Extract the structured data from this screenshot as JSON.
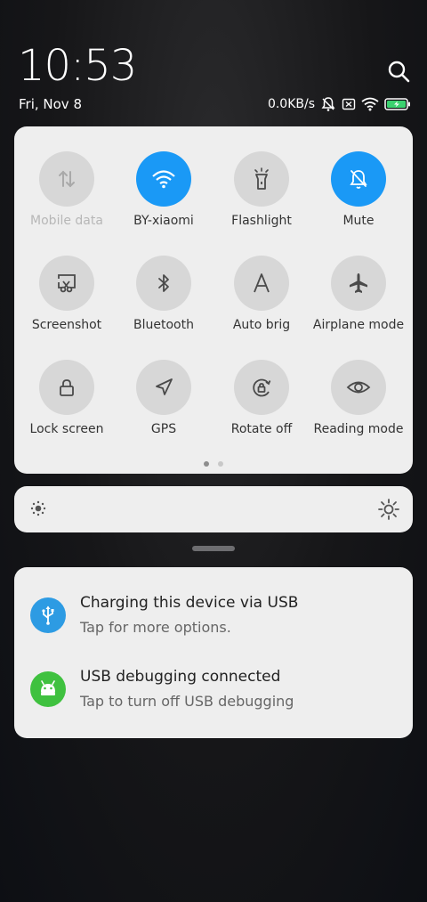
{
  "status": {
    "time": "10:53",
    "date": "Fri, Nov 8",
    "net_speed": "0.0KB/s"
  },
  "tiles": [
    {
      "label": "Mobile data",
      "state": "disabled",
      "icon": "mobile-data-icon"
    },
    {
      "label": "BY-xiaomi",
      "state": "on",
      "icon": "wifi-icon"
    },
    {
      "label": "Flashlight",
      "state": "off",
      "icon": "flashlight-icon"
    },
    {
      "label": "Mute",
      "state": "on",
      "icon": "mute-bell-icon"
    },
    {
      "label": "Screenshot",
      "state": "off",
      "icon": "screenshot-icon"
    },
    {
      "label": "Bluetooth",
      "state": "off",
      "icon": "bluetooth-icon"
    },
    {
      "label": "Auto brig",
      "state": "off",
      "icon": "auto-brightness-icon"
    },
    {
      "label": "Airplane mode",
      "state": "off",
      "icon": "airplane-icon"
    },
    {
      "label": "Lock screen",
      "state": "off",
      "icon": "lock-icon"
    },
    {
      "label": "GPS",
      "state": "off",
      "icon": "gps-icon"
    },
    {
      "label": "Rotate off",
      "state": "off",
      "icon": "rotate-lock-icon"
    },
    {
      "label": "Reading mode",
      "state": "off",
      "icon": "eye-icon"
    }
  ],
  "pager": {
    "pages": 2,
    "current": 1
  },
  "notifications": [
    {
      "title": "Charging this device via USB",
      "subtitle": "Tap for more options.",
      "icon": "usb-icon",
      "color": "#2d9be3"
    },
    {
      "title": "USB debugging connected",
      "subtitle": "Tap to turn off USB debugging",
      "icon": "android-icon",
      "color": "#3fc13f"
    }
  ],
  "colors": {
    "accent": "#1a99f6",
    "tile_off": "#d7d7d7",
    "panel": "#eeeeee"
  }
}
